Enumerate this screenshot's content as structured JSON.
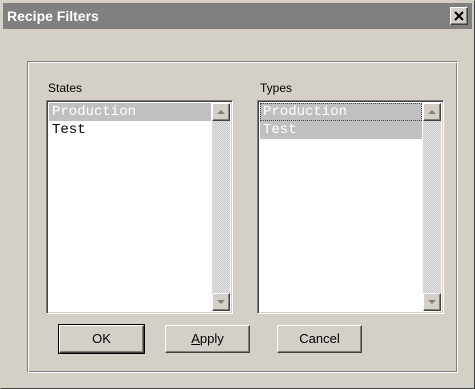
{
  "window": {
    "title": "Recipe Filters"
  },
  "states": {
    "label": "States",
    "items": [
      {
        "text": "Production",
        "selected": true
      },
      {
        "text": "Test",
        "selected": false
      }
    ]
  },
  "types": {
    "label": "Types",
    "items": [
      {
        "text": "Production",
        "selected": true
      },
      {
        "text": "Test",
        "selected": true
      }
    ]
  },
  "buttons": {
    "ok": "OK",
    "apply_mnemonic": "A",
    "apply_rest": "pply",
    "cancel": "Cancel"
  },
  "icons": {
    "close": "close-icon",
    "scroll_up": "arrow-up-icon",
    "scroll_down": "arrow-down-icon"
  },
  "colors": {
    "titlebar": "#808080",
    "face": "#d4d0c8",
    "selection": "#c0c0c0"
  }
}
